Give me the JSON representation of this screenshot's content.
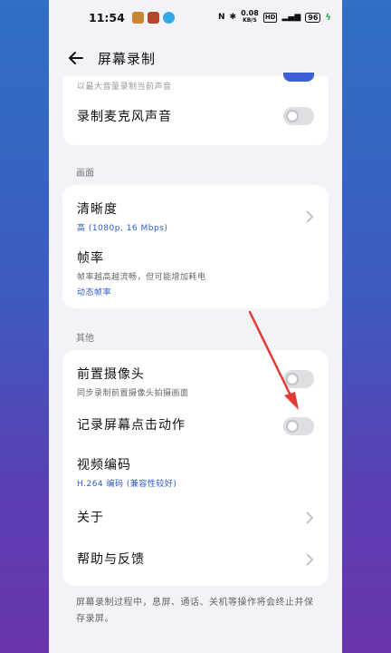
{
  "status_bar": {
    "time": "11:54",
    "speed_value": "0.08",
    "speed_unit": "KB/S",
    "hd": "HD",
    "battery": "96"
  },
  "nav": {
    "title": "屏幕录制"
  },
  "top_card": {
    "clipped_text": "以最大音量录制当前声音",
    "microphone_label": "录制麦克风声音",
    "microphone_on": false
  },
  "sections": {
    "picture_label": "画面",
    "other_label": "其他"
  },
  "picture_card": {
    "clarity_label": "清晰度",
    "clarity_value": "高 (1080p, 16 Mbps)",
    "framerate_label": "帧率",
    "framerate_desc": "帧率越高越流畅，但可能增加耗电",
    "framerate_value": "动态帧率"
  },
  "other_card": {
    "front_camera_label": "前置摄像头",
    "front_camera_desc": "同步录制前置摄像头拍摄画面",
    "front_camera_on": false,
    "touch_record_label": "记录屏幕点击动作",
    "touch_record_on": false,
    "video_codec_label": "视频编码",
    "video_codec_value": "H.264 编码 (兼容性较好)",
    "about_label": "关于",
    "help_label": "帮助与反馈"
  },
  "footer": {
    "note": "屏幕录制过程中，息屏、通话、关机等操作将会终止并保存录屏。"
  },
  "colors": {
    "accent": "#2a58c9",
    "annotation_arrow": "#e53935",
    "toggle_off": "#dedee3"
  }
}
